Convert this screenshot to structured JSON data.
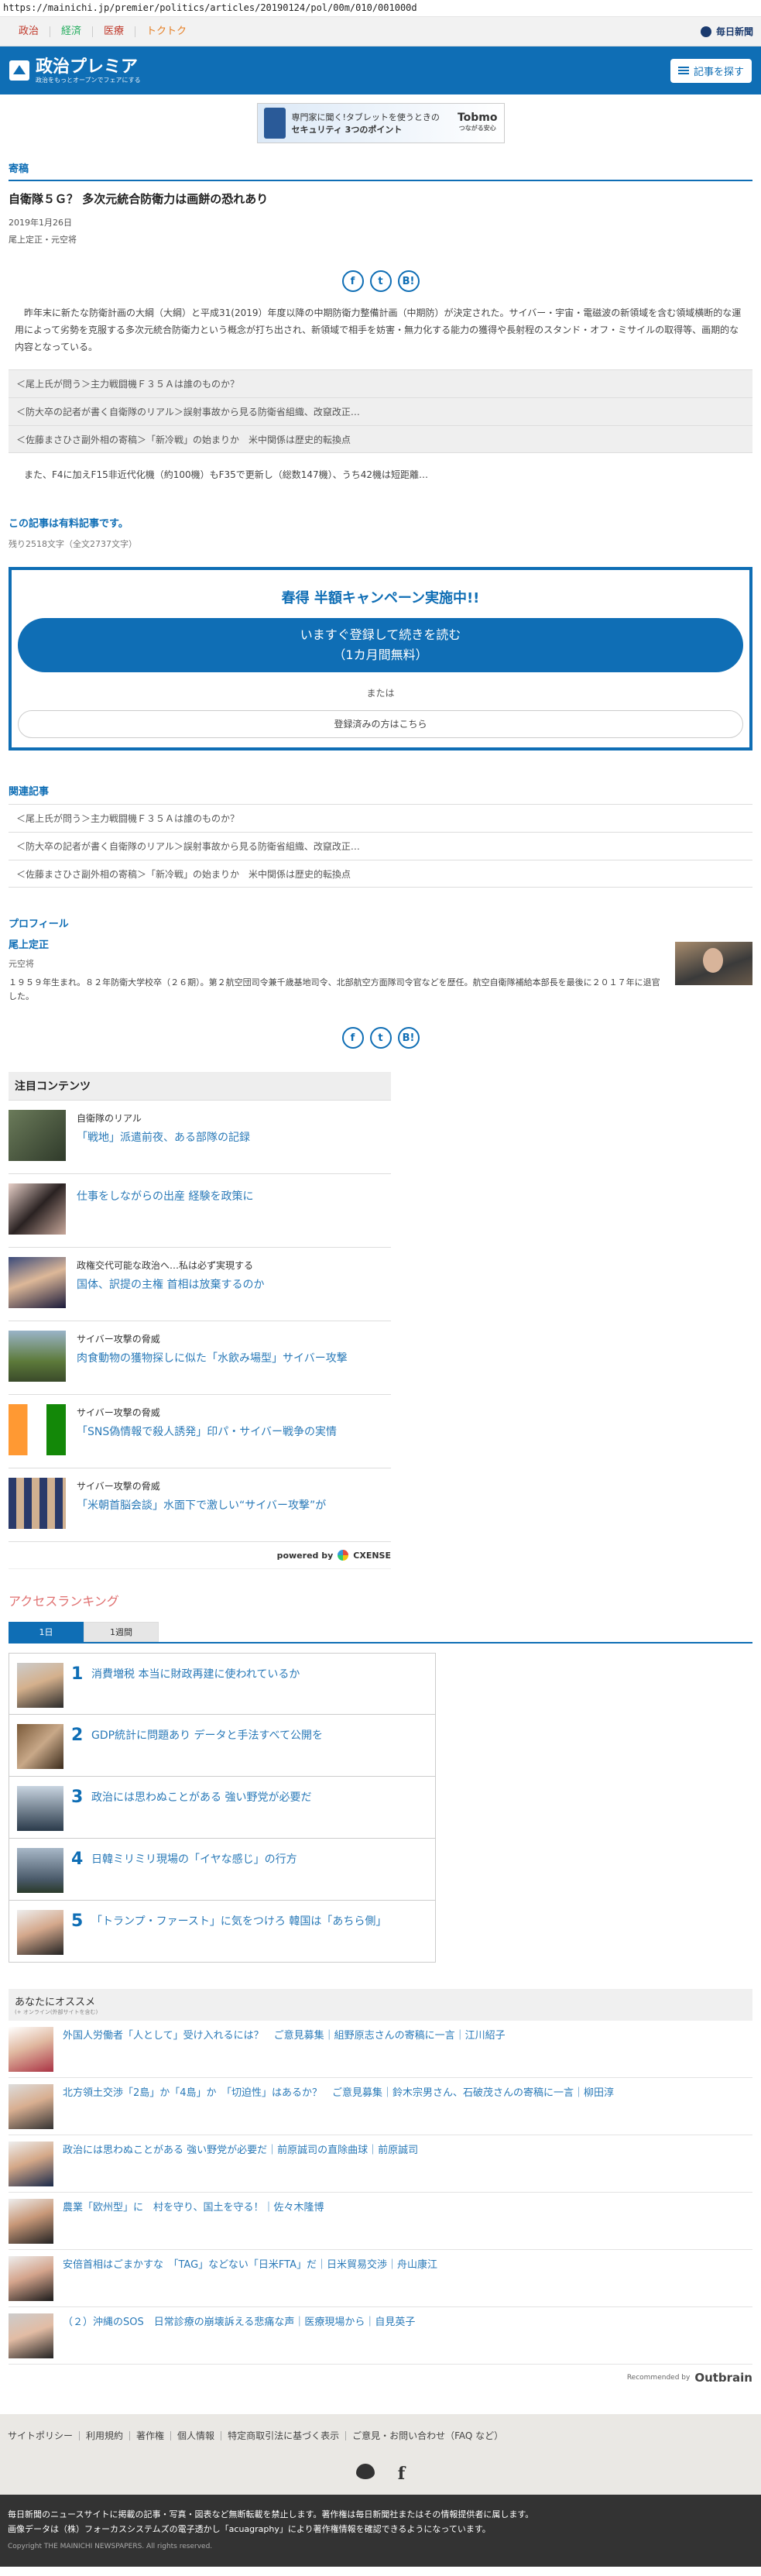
{
  "browser": {
    "url": "https://mainichi.jp/premier/politics/articles/20190124/pol/00m/010/001000d"
  },
  "topnav": {
    "links": [
      "政治",
      "経済",
      "医療",
      "トクトク"
    ],
    "link_colors": [
      "#c0392b",
      "#27ae60",
      "#c0392b",
      "#e67e22"
    ],
    "mainichi_logo": "毎日新聞"
  },
  "header": {
    "title": "政治プレミア",
    "subtitle": "政治をもっとオープンでフェアにする",
    "search_label": "記事を探す"
  },
  "ad": {
    "text1": "専門家に聞く!タブレットを使うときの",
    "text2": "セキュリティ 3つのポイント",
    "brand": "Tobmo",
    "brand_sub": "つながる安心"
  },
  "article": {
    "section": "寄稿",
    "title": "自衛隊５Ｇ？ 多次元統合防衛力は画餅の恐れあり",
    "date": "2019年1月26日",
    "author": "尾上定正・元空将",
    "lead": "昨年末に新たな防衛計画の大綱（大綱）と平成31(2019）年度以降の中期防衛力整備計画（中期防）が決定された。サイバー・宇宙・電磁波の新領域を含む領域横断的な運用によって劣勢を克服する多次元統合防衛力という概念が打ち出され、新領域で相手を妨害・無力化する能力の獲得や長射程のスタンド・オフ・ミサイルの取得等、画期的な内容となっている。",
    "links": [
      "＜尾上氏が問う＞主力戦闘機Ｆ３５Ａは誰のものか？",
      "＜防大卒の記者が書く自衛隊のリアル＞誤射事故から見る防衛省組織、改竄改正…",
      "＜佐藤まさひさ副外相の寄稿＞「新冷戦」の始まりか　米中関係は歴史的転換点"
    ],
    "teaser": "また、F4に加えF15非近代化機（約100機）もF35で更新し（総数147機）、うち42機は短距離…",
    "paid_notice": "この記事は有料記事です。",
    "remaining": "残り2518文字（全文2737文字）"
  },
  "campaign": {
    "title": "春得 半額キャンペーン実施中!!",
    "cta_line1": "いますぐ登録して続きを読む",
    "cta_line2": "（1カ月間無料）",
    "or": "または",
    "login": "登録済みの方はこちら"
  },
  "related": {
    "heading": "関連記事",
    "links": [
      "＜尾上氏が問う＞主力戦闘機Ｆ３５Ａは誰のものか？",
      "＜防大卒の記者が書く自衛隊のリアル＞誤射事故から見る防衛省組織、改竄改正…",
      "＜佐藤まさひさ副外相の寄稿＞「新冷戦」の始まりか　米中関係は歴史的転換点"
    ]
  },
  "profile": {
    "heading": "プロフィール",
    "name": "尾上定正",
    "role": "元空将",
    "bio": "１９５９年生まれ。８２年防衛大学校卒（２６期）。第２航空団司令兼千歳基地司令、北部航空方面隊司令官などを歴任。航空自衛隊補給本部長を最後に２０１７年に退官した。"
  },
  "attention": {
    "heading": "注目コンテンツ",
    "items": [
      {
        "category": "自衛隊のリアル",
        "title": "「戦地」派遣前夜、ある部隊の記録"
      },
      {
        "category": "",
        "title": "仕事をしながらの出産 経験を政策に"
      },
      {
        "category": "政権交代可能な政治へ…私は必ず実現する",
        "title": "国体、訳提の主権 首相は放棄するのか"
      },
      {
        "category": "サイバー攻撃の脅威",
        "title": "肉食動物の獲物探しに似た「水飲み場型」サイバー攻撃"
      },
      {
        "category": "サイバー攻撃の脅威",
        "title": "「SNS偽情報で殺人誘発」印パ・サイバー戦争の実情"
      },
      {
        "category": "サイバー攻撃の脅威",
        "title": "「米朝首脳会談」水面下で激しい“サイバー攻撃”が"
      }
    ],
    "powered_by": "powered by",
    "powered_brand": "CXENSE"
  },
  "ranking": {
    "heading": "アクセスランキング",
    "tabs": [
      "1日",
      "1週間"
    ],
    "items": [
      {
        "rank": "1",
        "title": "消費増税 本当に財政再建に使われているか"
      },
      {
        "rank": "2",
        "title": "GDP統計に問題あり データと手法すべて公開を"
      },
      {
        "rank": "3",
        "title": "政治には思わぬことがある 強い野党が必要だ"
      },
      {
        "rank": "4",
        "title": "日韓ミリミリ現場の「イヤな感じ」の行方"
      },
      {
        "rank": "5",
        "title": "「トランプ・ファースト」に気をつけろ 韓国は「あちら側」"
      }
    ]
  },
  "recommend": {
    "heading": "あなたにオススメ",
    "subheading": "(+ オンライン(外部サイトを含む)",
    "items": [
      "外国人労働者「人として」受け入れるには？　ご意見募集｜組野原志さんの寄稿に一言｜江川紹子",
      "北方領土交渉「2島」か「4島」か　「切迫性」はあるか？　ご意見募集｜鈴木宗男さん、石破茂さんの寄稿に一言｜柳田淳",
      "政治には思わぬことがある 強い野党が必要だ｜前原誠司の直除曲球｜前原誠司",
      "農業「欧州型」に　村を守り、国土を守る！｜佐々木隆博",
      "安倍首相はごまかすな　「TAG」などない「日米FTA」だ｜日米貿易交渉｜舟山康江",
      "（２）沖縄のSOS　日常診療の崩壊訴える悲痛な声｜医療現場から｜自見英子"
    ],
    "outbrain_label": "Recommended by",
    "outbrain_brand": "Outbrain"
  },
  "footer": {
    "links": [
      "サイトポリシー",
      "利用規約",
      "著作権",
      "個人情報",
      "特定商取引法に基づく表示",
      "ご意見・お問い合わせ（FAQ など）"
    ],
    "notice1": "毎日新聞のニュースサイトに掲載の記事・写真・図表など無断転載を禁止します。著作権は毎日新聞社またはその情報提供者に属します。",
    "notice2": "画像データは（株）フォーカスシステムズの電子透かし「acuagraphy」により著作権情報を確認できるようになっています。",
    "copyright": "Copyright THE MAINICHI NEWSPAPERS. All rights reserved."
  }
}
